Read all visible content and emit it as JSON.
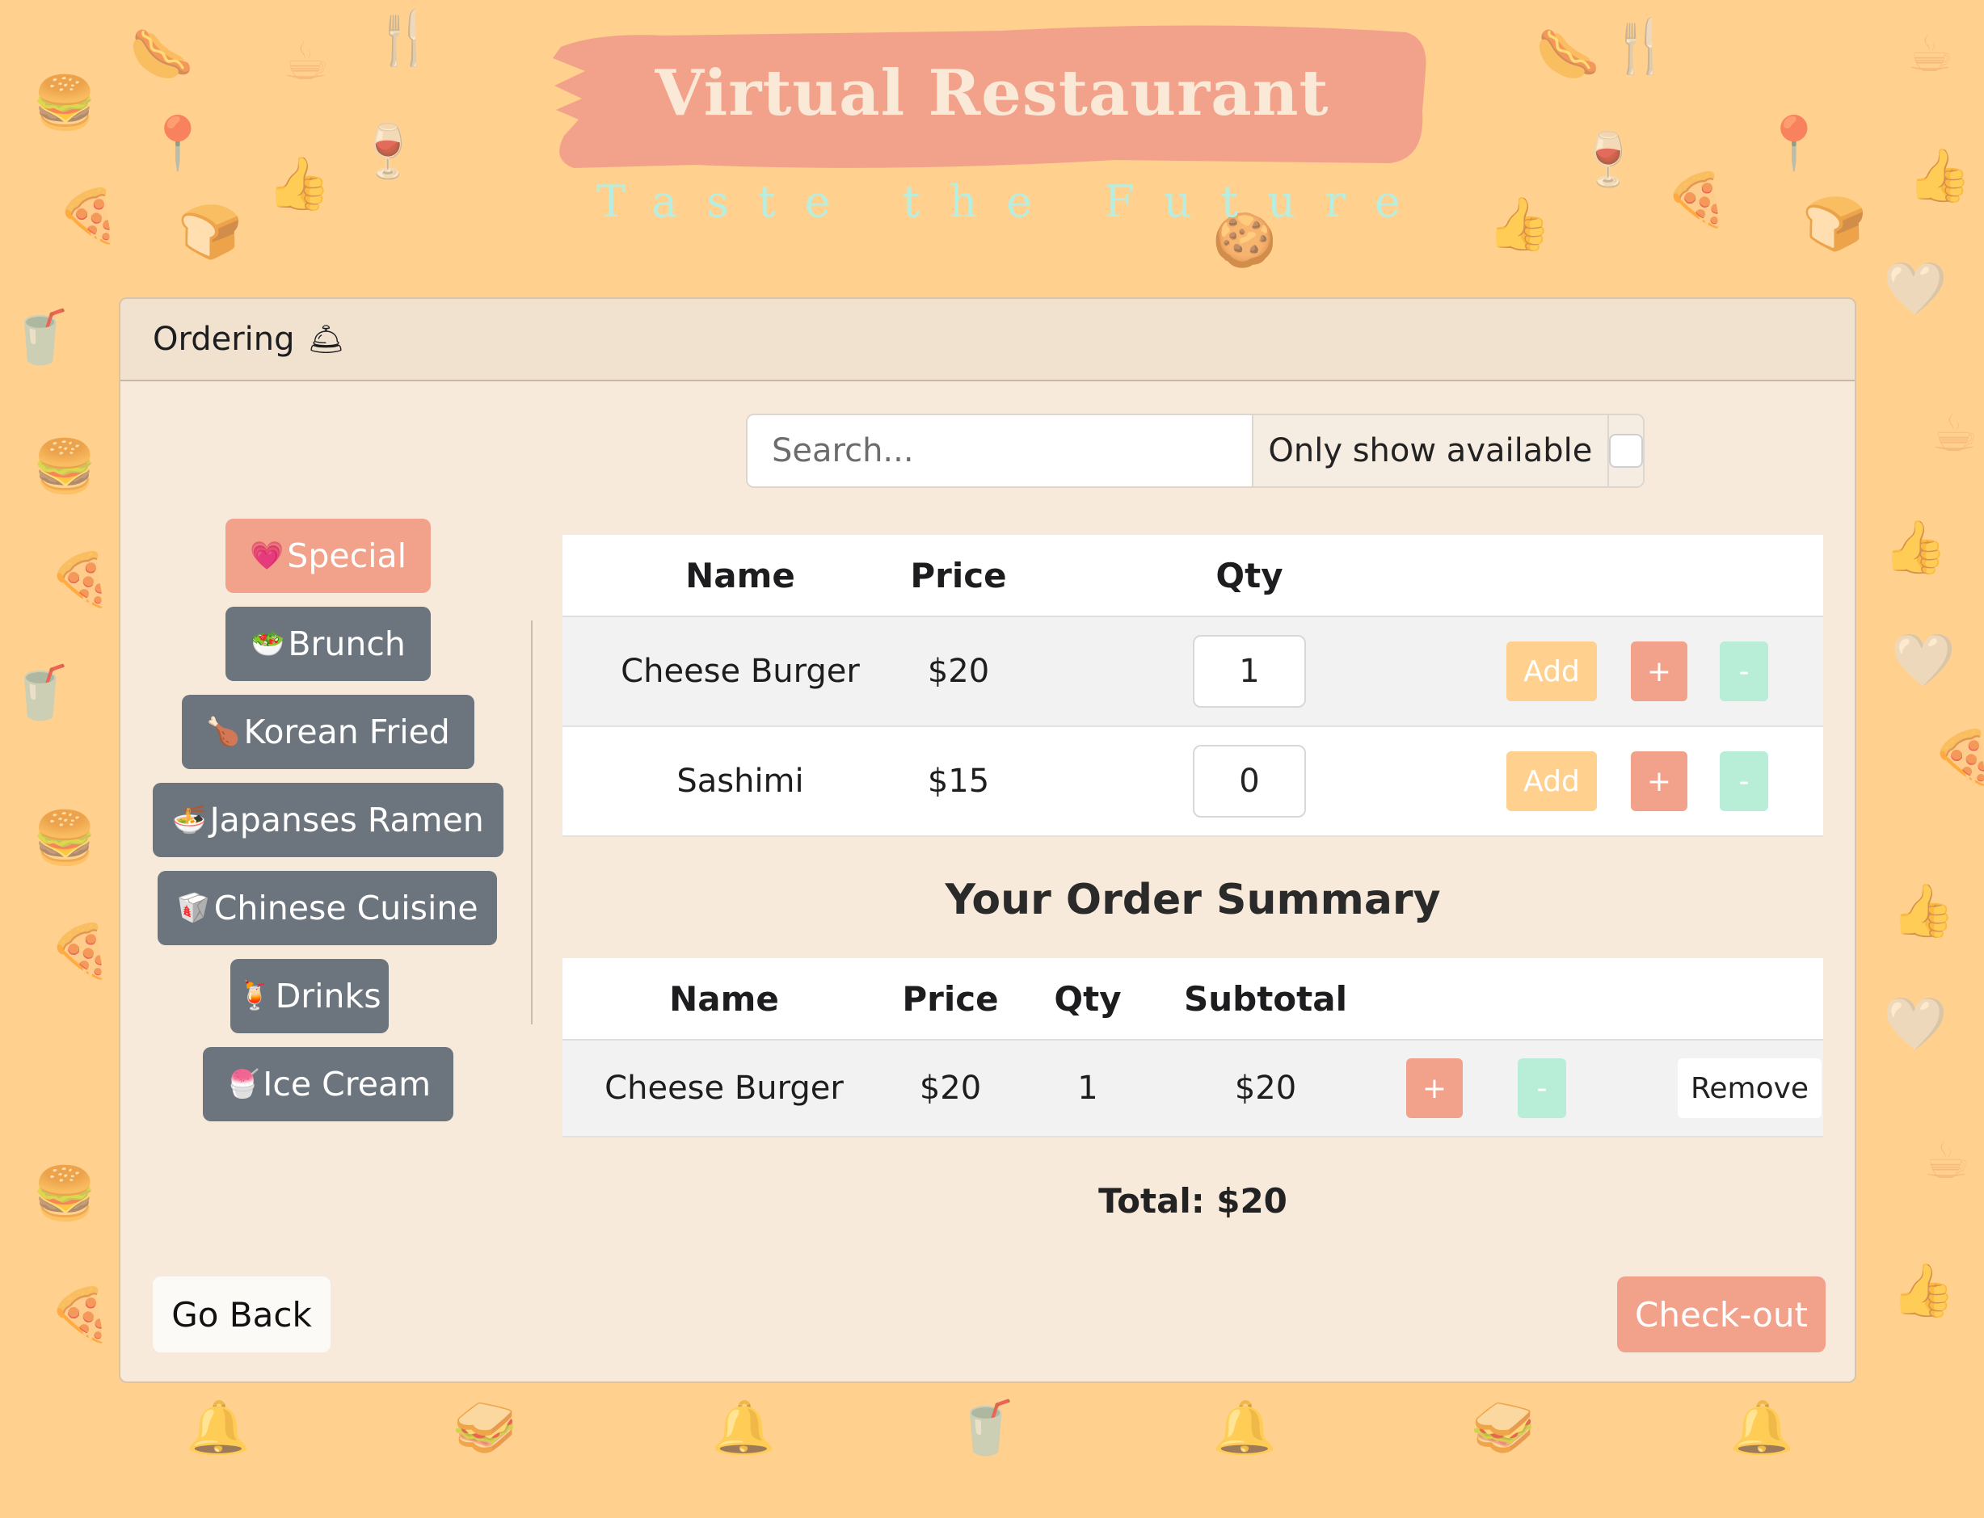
{
  "header": {
    "title": "Virtual Restaurant",
    "tagline": "Taste the Future"
  },
  "card": {
    "title": "Ordering",
    "title_icon": "bell-icon"
  },
  "search": {
    "placeholder": "Search...",
    "value": "",
    "filter_label": "Only show available",
    "filter_checked": false
  },
  "categories": [
    {
      "label": "Special",
      "icon": "heart-icon",
      "emoji": "💗",
      "active": true
    },
    {
      "label": "Brunch",
      "icon": "salad-bowl-icon",
      "emoji": "🥗",
      "active": false
    },
    {
      "label": "Korean Fried",
      "icon": "chicken-leg-icon",
      "emoji": "🍗",
      "active": false
    },
    {
      "label": "Japanses Ramen",
      "icon": "ramen-bowl-icon",
      "emoji": "🍜",
      "active": false
    },
    {
      "label": "Chinese Cuisine",
      "icon": "takeout-box-icon",
      "emoji": "🥡",
      "active": false
    },
    {
      "label": "Drinks",
      "icon": "tropical-drink-icon",
      "emoji": "🍹",
      "active": false
    },
    {
      "label": "Ice Cream",
      "icon": "shaved-ice-icon",
      "emoji": "🍧",
      "active": false
    }
  ],
  "menu": {
    "headers": {
      "name": "Name",
      "price": "Price",
      "qty": "Qty"
    },
    "add_label": "Add",
    "plus_label": "+",
    "minus_label": "-",
    "items": [
      {
        "name": "Cheese Burger",
        "price": "$20",
        "qty": "1"
      },
      {
        "name": "Sashimi",
        "price": "$15",
        "qty": "0"
      }
    ]
  },
  "summary": {
    "title": "Your Order Summary",
    "headers": {
      "name": "Name",
      "price": "Price",
      "qty": "Qty",
      "subtotal": "Subtotal"
    },
    "remove_label": "Remove",
    "rows": [
      {
        "name": "Cheese Burger",
        "price": "$20",
        "qty": "1",
        "subtotal": "$20"
      }
    ],
    "total_label": "Total: $20"
  },
  "actions": {
    "back_label": "Go Back",
    "checkout_label": "Check-out"
  },
  "colors": {
    "background": "#ffd08e",
    "accent": "#f2a28a",
    "mint": "#b8eed8",
    "card": "#f8eadb",
    "category_default": "#6c757d"
  }
}
